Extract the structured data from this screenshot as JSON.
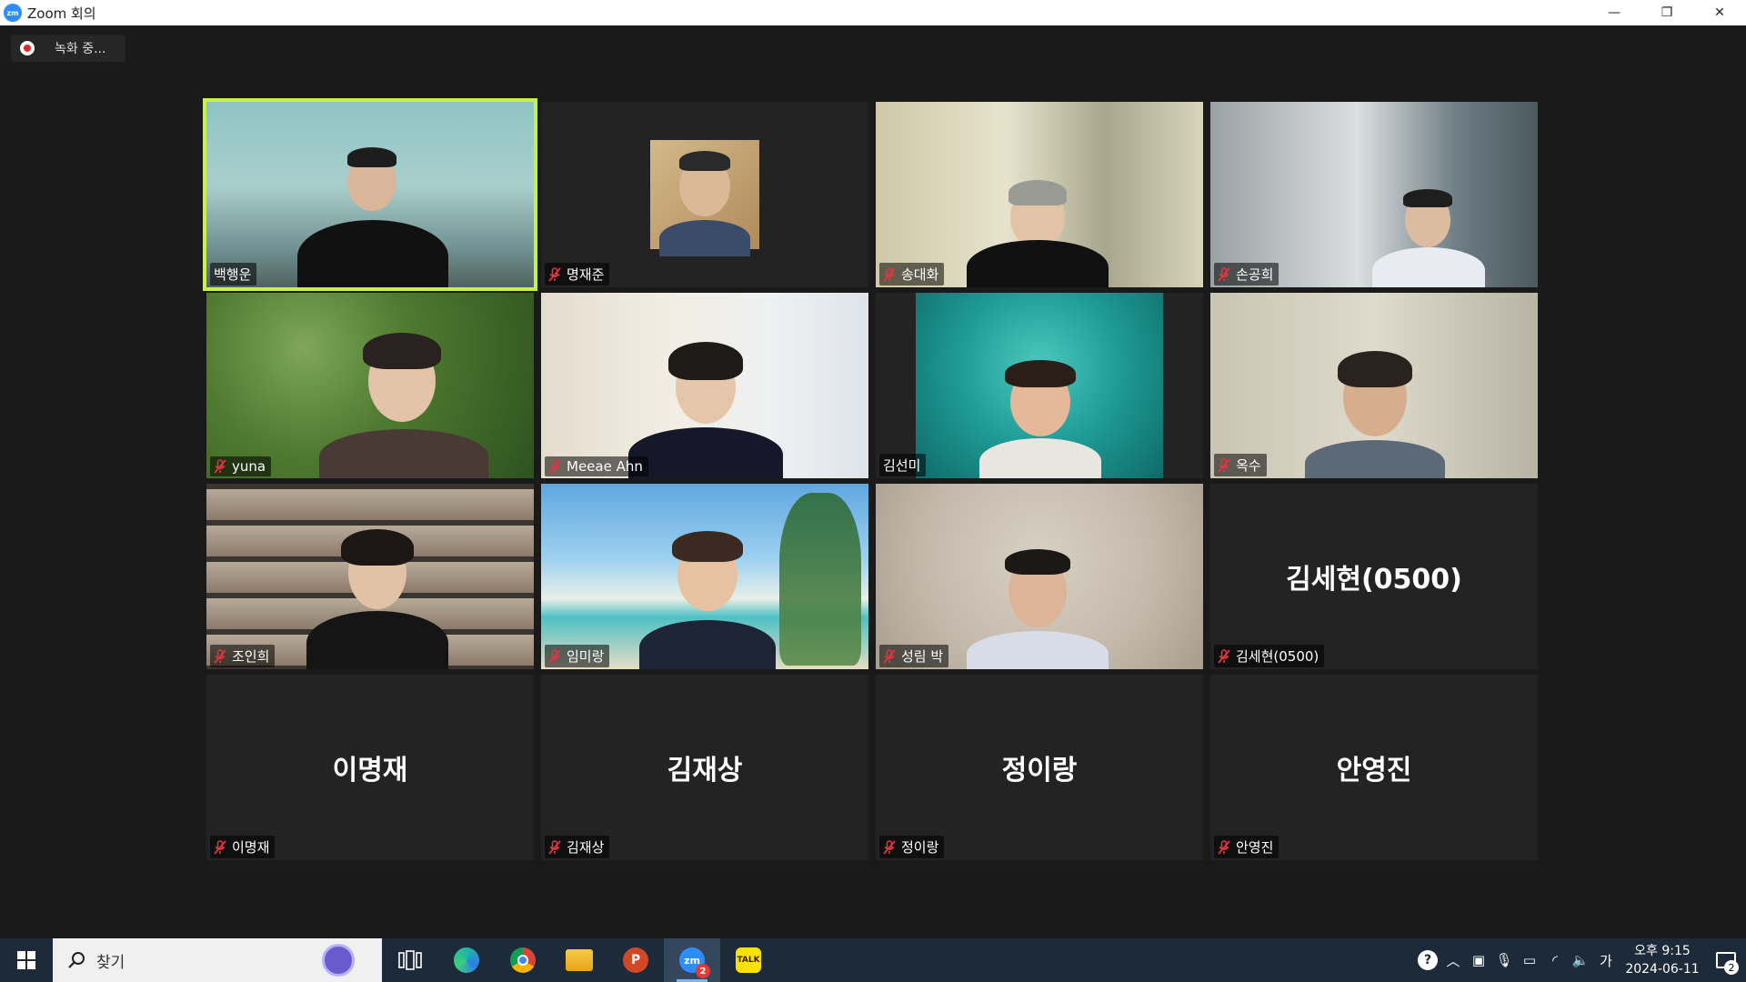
{
  "window": {
    "title": "Zoom 회의",
    "logo_text": "zm",
    "controls": {
      "minimize": "—",
      "restore": "❐",
      "close": "✕"
    }
  },
  "recording": {
    "label": "녹화 중..."
  },
  "participants": [
    {
      "name": "백행운",
      "muted": false,
      "video": true,
      "active": true
    },
    {
      "name": "명재준",
      "muted": true,
      "video": true
    },
    {
      "name": "송대화",
      "muted": true,
      "video": true
    },
    {
      "name": "손공희",
      "muted": true,
      "video": true
    },
    {
      "name": "yuna",
      "muted": true,
      "video": true
    },
    {
      "name": "Meeae Ahn",
      "muted": true,
      "video": true
    },
    {
      "name": "김선미",
      "muted": false,
      "video": true
    },
    {
      "name": "옥수",
      "muted": true,
      "video": true
    },
    {
      "name": "조인희",
      "muted": true,
      "video": true
    },
    {
      "name": "임미랑",
      "muted": true,
      "video": true
    },
    {
      "name": "성림 박",
      "muted": true,
      "video": true
    },
    {
      "name": "김세현(0500)",
      "muted": true,
      "video": false,
      "center_label": "김세현(0500)"
    },
    {
      "name": "이명재",
      "muted": true,
      "video": false,
      "center_label": "이명재"
    },
    {
      "name": "김재상",
      "muted": true,
      "video": false,
      "center_label": "김재상"
    },
    {
      "name": "정이랑",
      "muted": true,
      "video": false,
      "center_label": "정이랑"
    },
    {
      "name": "안영진",
      "muted": true,
      "video": false,
      "center_label": "안영진"
    }
  ],
  "taskbar": {
    "search_placeholder": "찾기",
    "apps": [
      {
        "name": "task-view",
        "label": ""
      },
      {
        "name": "edge",
        "label": ""
      },
      {
        "name": "chrome",
        "label": ""
      },
      {
        "name": "file-explorer",
        "label": ""
      },
      {
        "name": "powerpoint",
        "label": "P"
      },
      {
        "name": "zoom",
        "label": "zm",
        "badge": "2"
      },
      {
        "name": "kakaotalk",
        "label": "TALK"
      }
    ],
    "tray": {
      "ime": "가",
      "time": "오후 9:15",
      "date": "2024-06-11",
      "notification_count": "2"
    }
  },
  "colors": {
    "active_speaker_border": "#c8f04a",
    "tile_bg": "#232323",
    "meeting_bg": "#1a1a1a",
    "taskbar_bg": "#1c2a3a",
    "mute_red": "#e0363c"
  }
}
